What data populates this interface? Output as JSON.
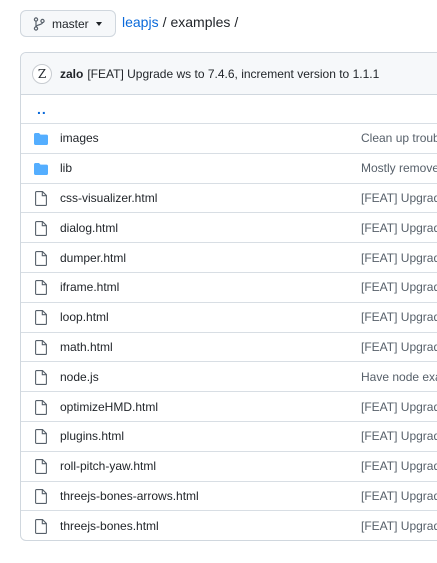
{
  "branch": {
    "label": "master",
    "icon": "git-branch-icon"
  },
  "breadcrumb": {
    "repo": "leapjs",
    "separator": "/",
    "dir": "examples",
    "trailing": "/"
  },
  "commit": {
    "avatar_letter": "Z",
    "author": "zalo",
    "message": "[FEAT] Upgrade ws to 7.4.6, increment version to 1.1.1"
  },
  "parent_dir": "..",
  "colors": {
    "link": "#0969da",
    "folder": "#54aeff",
    "border": "#d0d7de"
  },
  "files": [
    {
      "name": "images",
      "type": "folder",
      "message": "Clean up troub"
    },
    {
      "name": "lib",
      "type": "folder",
      "message": "Mostly remove"
    },
    {
      "name": "css-visualizer.html",
      "type": "file",
      "message": "[FEAT] Upgrad"
    },
    {
      "name": "dialog.html",
      "type": "file",
      "message": "[FEAT] Upgrad"
    },
    {
      "name": "dumper.html",
      "type": "file",
      "message": "[FEAT] Upgrad"
    },
    {
      "name": "iframe.html",
      "type": "file",
      "message": "[FEAT] Upgrad"
    },
    {
      "name": "loop.html",
      "type": "file",
      "message": "[FEAT] Upgrad"
    },
    {
      "name": "math.html",
      "type": "file",
      "message": "[FEAT] Upgrad"
    },
    {
      "name": "node.js",
      "type": "file",
      "message": "Have node exa"
    },
    {
      "name": "optimizeHMD.html",
      "type": "file",
      "message": "[FEAT] Upgrad"
    },
    {
      "name": "plugins.html",
      "type": "file",
      "message": "[FEAT] Upgrad"
    },
    {
      "name": "roll-pitch-yaw.html",
      "type": "file",
      "message": "[FEAT] Upgrad"
    },
    {
      "name": "threejs-bones-arrows.html",
      "type": "file",
      "message": "[FEAT] Upgrad"
    },
    {
      "name": "threejs-bones.html",
      "type": "file",
      "message": "[FEAT] Upgrad"
    }
  ]
}
